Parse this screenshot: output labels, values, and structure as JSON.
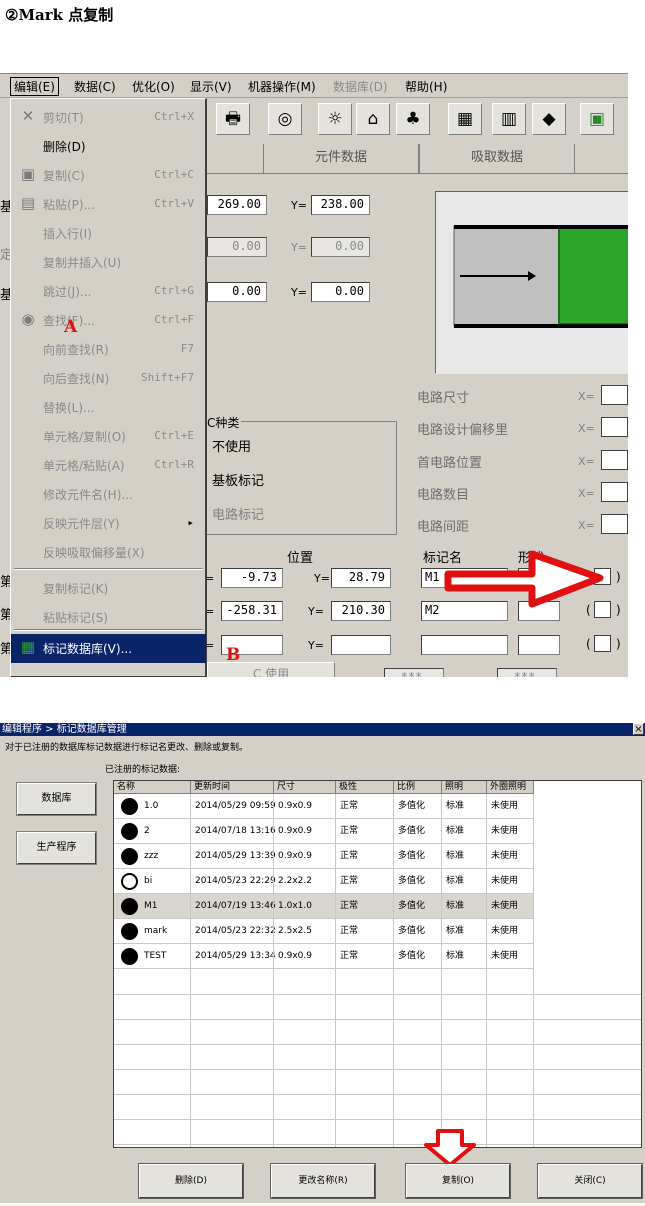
{
  "doc": {
    "heading": "②Mark 点复制"
  },
  "app": {
    "menubar": [
      {
        "label": "编辑(E)",
        "active": true
      },
      {
        "label": "数据(C)"
      },
      {
        "label": "优化(O)"
      },
      {
        "label": "显示(V)"
      },
      {
        "label": "机器操作(M)"
      },
      {
        "label": "数据库(D)",
        "disabled": true
      },
      {
        "label": "帮助(H)"
      }
    ],
    "tabs": [
      "元件数据",
      "吸取数据"
    ],
    "edit_menu": [
      {
        "label": "剪切(T)",
        "shortcut": "Ctrl+X",
        "icon": "✕"
      },
      {
        "label": "删除(D)",
        "enabled": true
      },
      {
        "label": "复制(C)",
        "shortcut": "Ctrl+C",
        "icon": "▣"
      },
      {
        "label": "粘贴(P)...",
        "shortcut": "Ctrl+V",
        "icon": "▤"
      },
      {
        "label": "插入行(I)"
      },
      {
        "label": "复制并插入(U)"
      },
      {
        "label": "跳过(J)...",
        "shortcut": "Ctrl+G"
      },
      {
        "label": "查找(F)...",
        "shortcut": "Ctrl+F",
        "icon": "◉"
      },
      {
        "label": "向前查找(R)",
        "shortcut": "F7"
      },
      {
        "label": "向后查找(N)",
        "shortcut": "Shift+F7"
      },
      {
        "label": "替换(L)..."
      },
      {
        "label": "单元格/复制(O)",
        "shortcut": "Ctrl+E"
      },
      {
        "label": "单元格/粘贴(A)",
        "shortcut": "Ctrl+R"
      },
      {
        "label": "修改元件名(H)..."
      },
      {
        "label": "反映元件层(Y)",
        "submenu": "▸"
      },
      {
        "label": "反映吸取偏移量(X)"
      },
      {
        "label": "复制标记(K)"
      },
      {
        "label": "粘贴标记(S)"
      },
      {
        "label": "标记数据库(V)...",
        "highlighted": true,
        "icon": "▦"
      }
    ],
    "annotation_a": "A",
    "annotation_b": "B",
    "fields": {
      "row1_x": "269.00",
      "row1_y": "238.00",
      "row2_x": "0.00",
      "row2_y": "0.00",
      "row3_x": "0.00",
      "row3_y": "0.00"
    },
    "y_label": "Y=",
    "equals": "=",
    "x_label": "X=",
    "left_edge_labels": [
      "基",
      "定",
      "基",
      "第",
      "第",
      "第"
    ],
    "mark_type_group": {
      "title": "C种类",
      "options": [
        "不使用",
        "基板标记",
        "电路标记"
      ]
    },
    "right_labels": [
      "电路尺寸",
      "电路设计偏移里",
      "首电路位置",
      "电路数目",
      "电路间距"
    ],
    "mark_table": {
      "headers": {
        "position": "位置",
        "mark_name": "标记名",
        "shape": "形状"
      },
      "rows": [
        {
          "x": "-9.73",
          "y": "28.79",
          "name": "M1"
        },
        {
          "x": "-258.31",
          "y": "210.30",
          "name": "M2"
        },
        {
          "x": "",
          "y": "",
          "name": ""
        }
      ]
    },
    "bottom_partial": {
      "button": "C 使用",
      "masked": "***"
    }
  },
  "dialog": {
    "title": "编辑程序 > 标记数据库管理",
    "close": "×",
    "description": "对于已注册的数据库标记数据进行标记名更改、删除或复制。",
    "table_label": "已注册的标记数据:",
    "sidebar": [
      "数据库",
      "生产程序"
    ],
    "columns": [
      "名称",
      "更新时间",
      "尺寸",
      "极性",
      "比例",
      "照明",
      "外圈照明"
    ],
    "rows": [
      {
        "name": "1.0",
        "time": "2014/05/29 09:59",
        "size": "0.9x0.9",
        "polarity": "正常",
        "ratio": "多值化",
        "light": "标准",
        "outer": "未使用",
        "hollow": false,
        "selected": false
      },
      {
        "name": "2",
        "time": "2014/07/18 13:16",
        "size": "0.9x0.9",
        "polarity": "正常",
        "ratio": "多值化",
        "light": "标准",
        "outer": "未使用",
        "hollow": false,
        "selected": false
      },
      {
        "name": "zzz",
        "time": "2014/05/29 13:39",
        "size": "0.9x0.9",
        "polarity": "正常",
        "ratio": "多值化",
        "light": "标准",
        "outer": "未使用",
        "hollow": false,
        "selected": false
      },
      {
        "name": "bi",
        "time": "2014/05/23 22:29",
        "size": "2.2x2.2",
        "polarity": "正常",
        "ratio": "多值化",
        "light": "标准",
        "outer": "未使用",
        "hollow": true,
        "selected": false
      },
      {
        "name": "M1",
        "time": "2014/07/19 13:46",
        "size": "1.0x1.0",
        "polarity": "正常",
        "ratio": "多值化",
        "light": "标准",
        "outer": "未使用",
        "hollow": false,
        "selected": true
      },
      {
        "name": "mark",
        "time": "2014/05/23 22:32",
        "size": "2.5x2.5",
        "polarity": "正常",
        "ratio": "多值化",
        "light": "标准",
        "outer": "未使用",
        "hollow": false,
        "selected": false
      },
      {
        "name": "TEST",
        "time": "2014/05/29 13:34",
        "size": "0.9x0.9",
        "polarity": "正常",
        "ratio": "多值化",
        "light": "标准",
        "outer": "未使用",
        "hollow": false,
        "selected": false
      }
    ],
    "buttons": {
      "delete": "删除(D)",
      "rename": "更改名称(R)",
      "copy": "复制(O)",
      "close": "关闭(C)"
    }
  },
  "colors": {
    "annotation_red": "#e01010",
    "menu_highlight": "#0a246a",
    "preview_green": "#2aa52a"
  }
}
